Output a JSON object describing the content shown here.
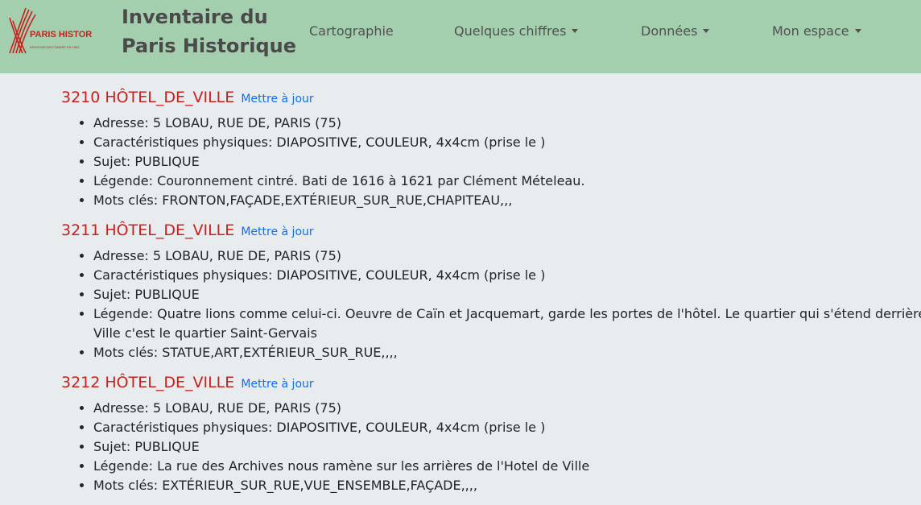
{
  "header": {
    "logo_text": "PARIS HISTORIQUE",
    "logo_subtext": "ASSOCIATION FONDÉE EN 1963",
    "brand_line1": "Inventaire du",
    "brand_line2": "Paris Historique",
    "brand_color": "#a3cfae",
    "nav": [
      {
        "label": "Cartographie",
        "dropdown": false
      },
      {
        "label": "Quelques chiffres",
        "dropdown": true
      },
      {
        "label": "Données",
        "dropdown": true
      },
      {
        "label": "Mon espace",
        "dropdown": true
      }
    ]
  },
  "records": [
    {
      "id": "3210 HÔTEL_DE_VILLE",
      "update_label": "Mettre à jour",
      "fields": [
        "Adresse: 5 LOBAU, RUE DE, PARIS (75)",
        "Caractéristiques physiques: DIAPOSITIVE, COULEUR, 4x4cm (prise le )",
        "Sujet: PUBLIQUE",
        "Légende: Couronnement cintré. Bati de 1616 à 1621 par Clément Mételeau.",
        "Mots clés: FRONTON,FAÇADE,EXTÉRIEUR_SUR_RUE,CHAPITEAU,,,"
      ]
    },
    {
      "id": "3211 HÔTEL_DE_VILLE",
      "update_label": "Mettre à jour",
      "fields": [
        "Adresse: 5 LOBAU, RUE DE, PARIS (75)",
        "Caractéristiques physiques: DIAPOSITIVE, COULEUR, 4x4cm (prise le )",
        "Sujet: PUBLIQUE",
        "Légende: Quatre lions comme celui-ci. Oeuvre de Caïn et Jacquemart, garde les portes de l'hôtel. Le quartier qui s'étend derrière de Ville c'est le quartier Saint-Gervais",
        "Mots clés: STATUE,ART,EXTÉRIEUR_SUR_RUE,,,,"
      ]
    },
    {
      "id": "3212 HÔTEL_DE_VILLE",
      "update_label": "Mettre à jour",
      "fields": [
        "Adresse: 5 LOBAU, RUE DE, PARIS (75)",
        "Caractéristiques physiques: DIAPOSITIVE, COULEUR, 4x4cm (prise le )",
        "Sujet: PUBLIQUE",
        "Légende: La rue des Archives nous ramène sur les arrières de l'Hotel de Ville",
        "Mots clés: EXTÉRIEUR_SUR_RUE,VUE_ENSEMBLE,FAÇADE,,,,"
      ]
    }
  ],
  "colors": {
    "record_title": "#c8201d",
    "link": "#0d6efd",
    "background": "#e9ecef"
  }
}
